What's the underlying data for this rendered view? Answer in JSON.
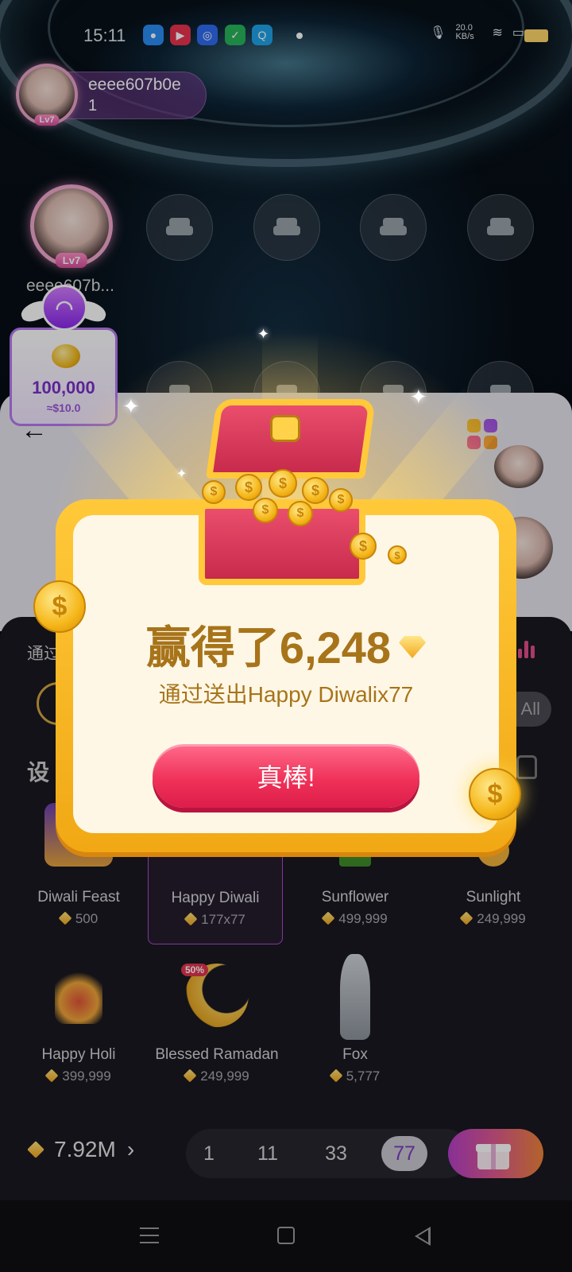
{
  "status_bar": {
    "time": "15:11",
    "net_speed": "20.0 KB/s",
    "icons": [
      "chat-app-icon",
      "video-app-icon",
      "browser-app-icon",
      "shield-app-icon",
      "search-app-icon"
    ]
  },
  "room": {
    "host_name": "eeee607b0e",
    "host_count": "1",
    "host_level": "Lv7",
    "seat_user_name": "eeee607b...",
    "seat_user_level": "Lv7"
  },
  "coin_box": {
    "amount": "100,000",
    "usd": "≈$10.0"
  },
  "reward_popup": {
    "title_prefix": "赢得了",
    "amount": "6,248",
    "subtitle": "通过送出Happy Diwalix77",
    "button_label": "真棒!"
  },
  "gift_panel": {
    "via_label": "通过",
    "all_label": "All",
    "settings_label": "设",
    "gifts": [
      {
        "name": "Diwali Feast",
        "price": "500"
      },
      {
        "name": "Happy Diwali",
        "price": "177x77"
      },
      {
        "name": "Sunflower",
        "price": "499,999"
      },
      {
        "name": "Sunlight",
        "price": "249,999"
      },
      {
        "name": "Happy Holi",
        "price": "399,999"
      },
      {
        "name": "Blessed Ramadan",
        "price": "249,999"
      },
      {
        "name": "Fox",
        "price": "5,777"
      }
    ],
    "discount_badge": "50%",
    "balance": "7.92M",
    "quantities": [
      "1",
      "11",
      "33",
      "77"
    ],
    "selected_quantity": "77"
  },
  "colors": {
    "accent_purple": "#b640c9",
    "reward_gold": "#a7741a",
    "button_red": "#f03259"
  }
}
